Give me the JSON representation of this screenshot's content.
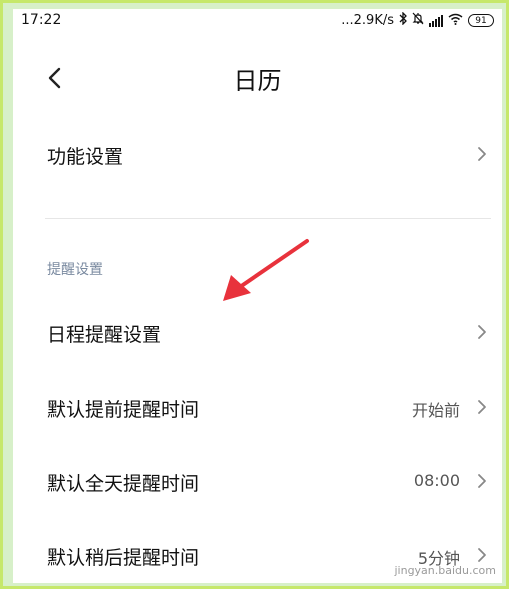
{
  "status_bar": {
    "time": "17:22",
    "network_speed": "...2.9K/s",
    "battery": "91"
  },
  "header": {
    "title": "日历"
  },
  "rows": {
    "function_settings": {
      "label": "功能设置"
    },
    "section_title": "提醒设置",
    "schedule_reminder": {
      "label": "日程提醒设置"
    },
    "default_advance": {
      "label": "默认提前提醒时间",
      "value": "开始前"
    },
    "default_allday": {
      "label": "默认全天提醒时间",
      "value": "08:00"
    },
    "default_snooze": {
      "label": "默认稍后提醒时间",
      "value": "5分钟"
    }
  },
  "watermark": "jingyan.baidu.com",
  "colors": {
    "annotation_arrow": "#e8323c",
    "frame_border": "#c6e86b",
    "background": "#d7f0c9"
  },
  "icons": [
    "back-icon",
    "chevron-right-icon",
    "bluetooth-icon",
    "wifi-icon",
    "signal-icon",
    "battery-icon"
  ]
}
